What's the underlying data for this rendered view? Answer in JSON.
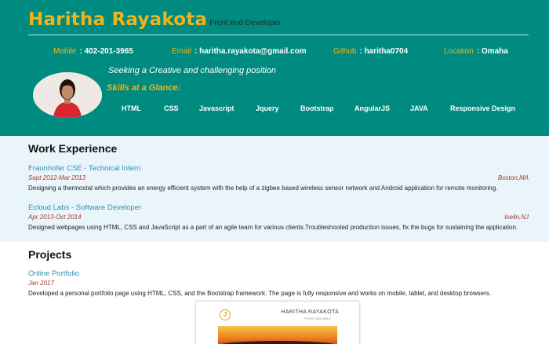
{
  "header": {
    "name": "Haritha Rayakota",
    "role": "Front end Developer",
    "contacts": [
      {
        "label": "Mobile",
        "value": ": 402-201-3965"
      },
      {
        "label": "Email",
        "value": ": haritha.rayakota@gmail.com"
      },
      {
        "label": "Github",
        "value": ": haritha0704"
      },
      {
        "label": "Location",
        "value": ": Omaha"
      }
    ],
    "tagline": "Seeking a Creative and challenging position",
    "skills_title": "Skills at a Glance:",
    "skills": [
      "HTML",
      "CSS",
      "Javascript",
      "Jquery",
      "Bootstrap",
      "AngularJS",
      "JAVA",
      "Responsive Design"
    ]
  },
  "work": {
    "title": "Work Experience",
    "jobs": [
      {
        "title": "Fraunhofer CSE - Technical Intern",
        "date": "Sept 2012-Mar 2013",
        "location": "Boston,MA",
        "description": "Designing a thermostat which provides an energy efficient system with the help of a zigbee based wireless sensor network and Android application for remote monitoring."
      },
      {
        "title": "Ecloud Labs - Software Developer",
        "date": "Apr 2013-Oct 2014",
        "location": "Iselin,NJ",
        "description": "Designed webpages using HTML, CSS and JavaScript as a part of an agile team for various clients.Troubleshooted production issues, fix the bugs for sustaining the application."
      }
    ]
  },
  "projects": {
    "title": "Projects",
    "items": [
      {
        "title": "Online Portfolio",
        "date": "Jan 2017",
        "description": "Developed a personal portfolio page using HTML, CSS, and the Bootstrap framework. The page is fully responsive and works on mobile, tablet, and desktop browsers."
      }
    ],
    "thumbnail": {
      "logo": "J",
      "name": "HARITHA RAYAKOTA",
      "subtitle": "FRONT END WALK"
    }
  },
  "colors": {
    "header_bg": "#008b80",
    "accent": "#f2b31a",
    "link": "#2e8fb3",
    "date": "#a33a2c",
    "work_bg": "#eaf5fb"
  }
}
